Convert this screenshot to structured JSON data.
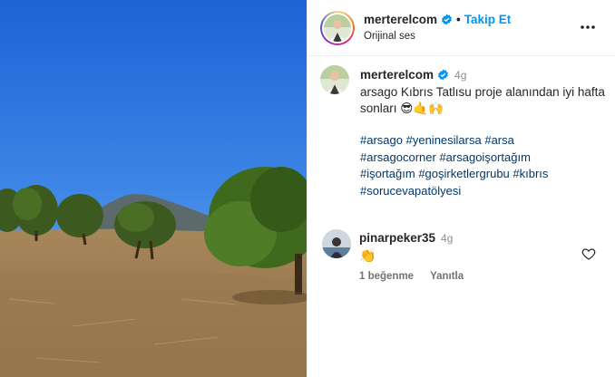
{
  "post": {
    "username": "merterelcom",
    "follow_label": "Takip Et",
    "separator": "•",
    "audio": "Orijinal ses"
  },
  "caption": {
    "username": "merterelcom",
    "time": "4g",
    "text": "arsago Kıbrıs Tatlısu proje alanından iyi hafta sonları 😎🤙🙌",
    "hashtags": [
      "#arsago",
      "#yeninesilarsa",
      "#arsa",
      "#arsagocorner",
      "#arsagoişortağım",
      "#işortağım",
      "#goşirketlergrubu",
      "#kıbrıs",
      "#sorucevapatölyesi"
    ]
  },
  "comment": {
    "username": "pinarpeker35",
    "time": "4g",
    "text": "👏",
    "likes_label": "1 beğenme",
    "reply_label": "Yanıtla"
  },
  "icons": {
    "verified": "verified-badge-icon",
    "more": "more-options-icon",
    "like": "heart-icon"
  },
  "colors": {
    "link_blue": "#0095f6",
    "hashtag": "#00376b",
    "muted": "#737373",
    "sky": "#3a7fe0"
  }
}
